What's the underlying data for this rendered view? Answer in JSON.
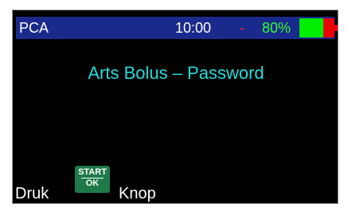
{
  "status_bar": {
    "app_title": "PCA",
    "clock": "10:00",
    "separator": "-",
    "battery_percent": "80%",
    "colors": {
      "bar_background": "#1a2a8c",
      "clock_text": "#ffffff",
      "separator": "#ff2222",
      "battery_percent_text": "#33ff33",
      "battery_charged": "#00ee00",
      "battery_empty": "#ee0000"
    },
    "battery_level_fraction": 0.68,
    "battery_icon": "battery-icon"
  },
  "screen": {
    "title": "Arts Bolus – Password",
    "title_color": "#22dcdc",
    "background": "#000000"
  },
  "footer": {
    "press_label": "Druk",
    "button_top_label": "START",
    "button_bottom_label": "OK",
    "button_label": "Knop",
    "button_color": "#1f7a4a"
  }
}
